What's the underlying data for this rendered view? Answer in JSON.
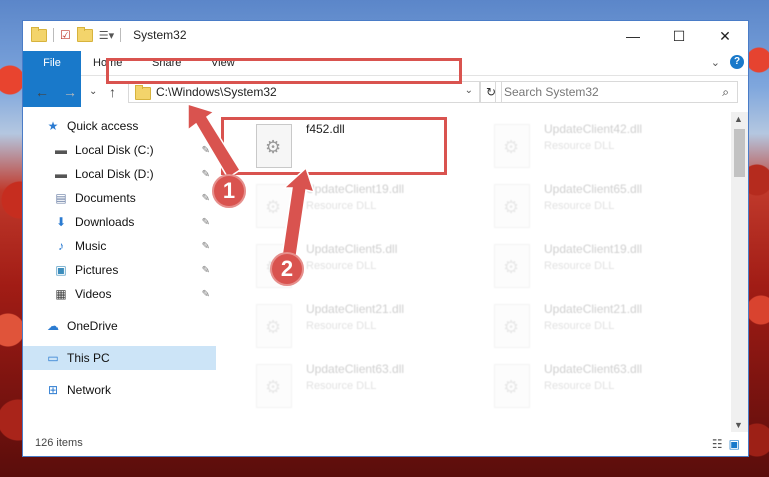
{
  "window": {
    "title": "System32",
    "controls": {
      "minimize": "—",
      "maximize": "☐",
      "close": "✕"
    }
  },
  "ribbon": {
    "tabs": [
      "File",
      "Home",
      "Share",
      "View"
    ],
    "expand": "⌄",
    "help": "?"
  },
  "navbar": {
    "back": "←",
    "forward": "→",
    "recent": "⌄",
    "up": "↑",
    "address": "C:\\Windows\\System32",
    "address_dropdown": "⌄",
    "refresh": "↻",
    "search_placeholder": "Search System32",
    "search_icon": "⌕"
  },
  "sidebar": {
    "items": [
      {
        "label": "Quick access",
        "icon": "star-icon",
        "glyph": "★",
        "color": "#2b7bd1",
        "pinned": false
      },
      {
        "label": "Local Disk (C:)",
        "icon": "drive-icon",
        "glyph": "▬",
        "color": "#555555",
        "pinned": true
      },
      {
        "label": "Local Disk (D:)",
        "icon": "drive-icon",
        "glyph": "▬",
        "color": "#555555",
        "pinned": true
      },
      {
        "label": "Documents",
        "icon": "documents-icon",
        "glyph": "▤",
        "color": "#6b7fa6",
        "pinned": true
      },
      {
        "label": "Downloads",
        "icon": "download-icon",
        "glyph": "⬇",
        "color": "#2b7bd1",
        "pinned": true
      },
      {
        "label": "Music",
        "icon": "music-icon",
        "glyph": "♪",
        "color": "#2b7bd1",
        "pinned": true
      },
      {
        "label": "Pictures",
        "icon": "pictures-icon",
        "glyph": "▣",
        "color": "#3c8dbc",
        "pinned": true
      },
      {
        "label": "Videos",
        "icon": "videos-icon",
        "glyph": "▦",
        "color": "#444444",
        "pinned": true
      },
      {
        "label": "OneDrive",
        "icon": "cloud-icon",
        "glyph": "☁",
        "color": "#2b7bd1",
        "pinned": false
      },
      {
        "label": "This PC",
        "icon": "computer-icon",
        "glyph": "▭",
        "color": "#2b7bd1",
        "pinned": false,
        "selected": true
      },
      {
        "label": "Network",
        "icon": "network-icon",
        "glyph": "⊞",
        "color": "#2b7bd1",
        "pinned": false
      }
    ],
    "pin_glyph": "📌"
  },
  "files": [
    {
      "name": "f452.dll",
      "type": "",
      "faded": false
    },
    {
      "name": "UpdateClient42.dll",
      "type": "Resource DLL",
      "faded": true
    },
    {
      "name": "UpdateClient19.dll",
      "type": "Resource DLL",
      "faded": true
    },
    {
      "name": "UpdateClient65.dll",
      "type": "Resource DLL",
      "faded": true
    },
    {
      "name": "UpdateClient5.dll",
      "type": "Resource DLL",
      "faded": true
    },
    {
      "name": "UpdateClient19.dll",
      "type": "Resource DLL",
      "faded": true
    },
    {
      "name": "UpdateClient21.dll",
      "type": "Resource DLL",
      "faded": true
    },
    {
      "name": "UpdateClient21.dll",
      "type": "Resource DLL",
      "faded": true
    },
    {
      "name": "UpdateClient63.dll",
      "type": "Resource DLL",
      "faded": true
    },
    {
      "name": "UpdateClient63.dll",
      "type": "Resource DLL",
      "faded": true
    }
  ],
  "status": {
    "count": "126 items",
    "details_view": "☷",
    "icons_view": "▣"
  },
  "annotations": {
    "step1": "1",
    "step2": "2",
    "color": "#d9534f"
  }
}
